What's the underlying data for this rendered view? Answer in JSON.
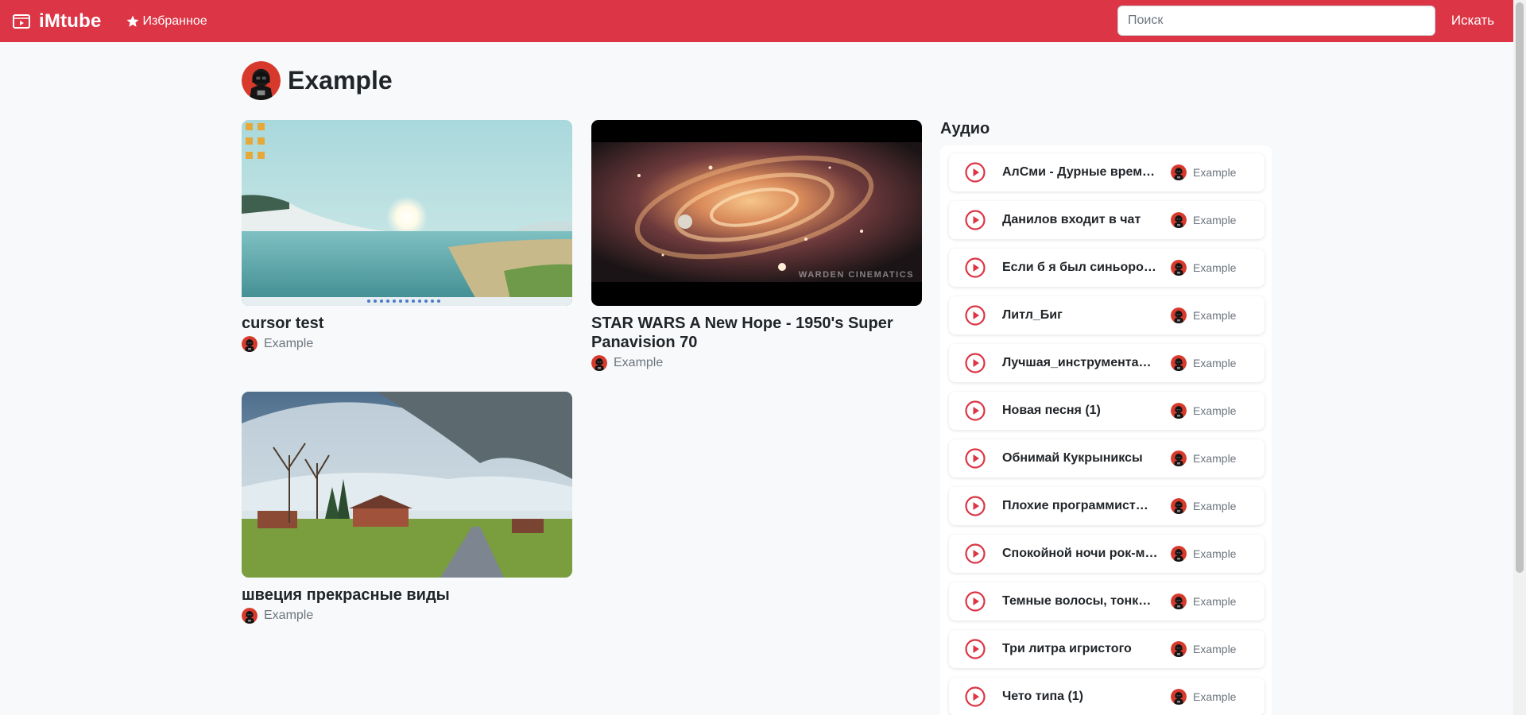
{
  "navbar": {
    "brand": "iMtube",
    "favorites_label": "Избранное",
    "search_placeholder": "Поиск",
    "search_value": "",
    "search_button": "Искать",
    "accent_color": "#dc3545"
  },
  "channel": {
    "name": "Example",
    "avatar_icon": "user-avatar"
  },
  "videos": [
    {
      "title": "cursor test",
      "author": "Example",
      "thumbnail": "desktop-lake-wallpaper"
    },
    {
      "title": "STAR WARS A New Hope - 1950's Super Panavision 70",
      "author": "Example",
      "thumbnail": "space-galaxy-spiral",
      "watermark": "WARDEN CINEMATICS"
    },
    {
      "title": "швеция прекрасные виды",
      "author": "Example",
      "thumbnail": "mountain-village-road"
    }
  ],
  "audio": {
    "heading": "Аудио",
    "items": [
      {
        "title": "АлСми - Дурные врем…",
        "author": "Example"
      },
      {
        "title": "Данилов входит в чат",
        "author": "Example"
      },
      {
        "title": "Если б я был синьоро…",
        "author": "Example"
      },
      {
        "title": "Литл_Биг",
        "author": "Example"
      },
      {
        "title": "Лучшая_инструментал…",
        "author": "Example"
      },
      {
        "title": "Новая песня (1)",
        "author": "Example"
      },
      {
        "title": "Обнимай Кукрыниксы",
        "author": "Example"
      },
      {
        "title": "Плохие программисты…",
        "author": "Example"
      },
      {
        "title": "Спокойной ночи рок-м…",
        "author": "Example"
      },
      {
        "title": "Темные волосы, тонки…",
        "author": "Example"
      },
      {
        "title": "Три литра игристого",
        "author": "Example"
      },
      {
        "title": "Чето типа (1)",
        "author": "Example"
      }
    ]
  }
}
